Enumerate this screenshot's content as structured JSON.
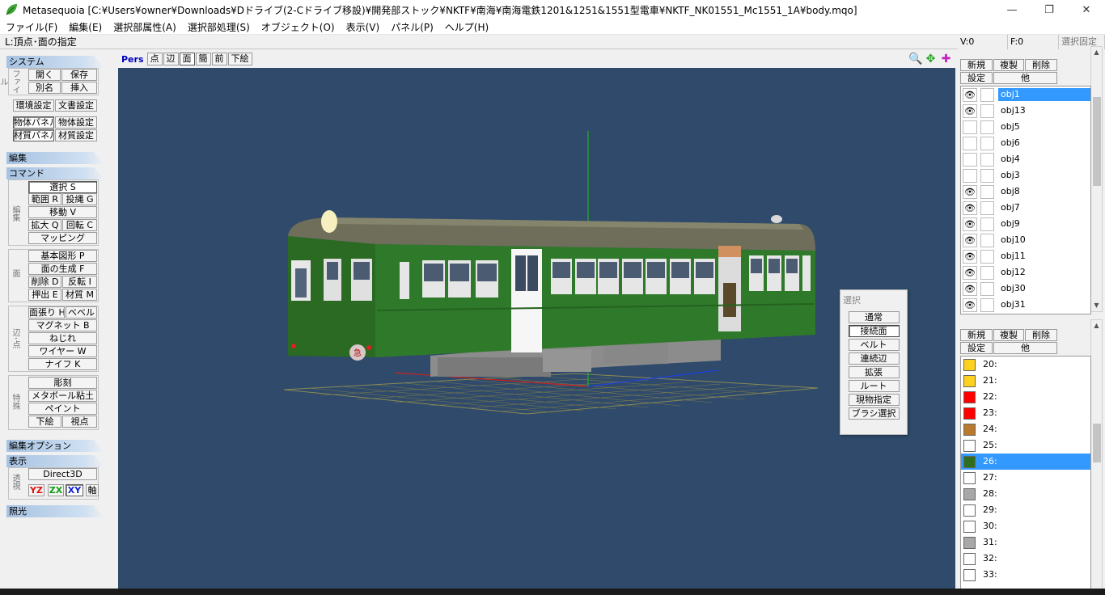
{
  "window": {
    "title": "Metasequoia [C:¥Users¥owner¥Downloads¥Dドライブ(2-Cドライブ移設)¥開発部ストック¥NKTF¥南海¥南海電鉄1201&1251&1551型電車¥NKTF_NK01551_Mc1551_1A¥body.mqo]",
    "minimize": "—",
    "maximize": "❐",
    "close": "✕"
  },
  "menu": [
    "ファイル(F)",
    "編集(E)",
    "選択部属性(A)",
    "選択部処理(S)",
    "オブジェクト(O)",
    "表示(V)",
    "パネル(P)",
    "ヘルプ(H)"
  ],
  "status": "L:頂点･面の指定",
  "left": {
    "system": {
      "header": "システム",
      "file_label": "ファイル",
      "open": "開く",
      "save": "保存",
      "rename": "別名",
      "insert": "挿入",
      "env": "環境設定",
      "doc": "文書設定",
      "objpanel": "物体パネル",
      "objset": "物体設定",
      "matpanel": "材質パネル",
      "matset": "材質設定"
    },
    "edit_header": "編集",
    "command": {
      "header": "コマンド",
      "edit_label": "編集",
      "select": "選択 S",
      "range": "範囲 R",
      "lasso": "投縄 G",
      "move": "移動 V",
      "scale": "拡大 Q",
      "rotate": "回転 C",
      "mapping": "マッピング",
      "face_label": "面",
      "primitive": "基本図形 P",
      "create_face": "面の生成 F",
      "delete": "削除 D",
      "flip": "反転 I",
      "extrude": "押出 E",
      "material": "材質 M",
      "edge_label": "辺･点",
      "facet": "面張り H",
      "bevel": "ベベル",
      "magnet": "マグネット B",
      "twist": "ねじれ",
      "wire": "ワイヤー W",
      "knife": "ナイフ K",
      "special_label": "特殊",
      "sculpt": "彫刻",
      "metaball": "メタボール粘土",
      "paint": "ペイント",
      "underlay": "下絵",
      "viewpoint": "視点"
    },
    "edit_option_header": "編集オプション",
    "display": {
      "header": "表示",
      "persp_label": "透視",
      "renderer": "Direct3D",
      "yz": "YZ",
      "zx": "ZX",
      "xy": "XY",
      "axis": "軸"
    },
    "lighting_header": "照光"
  },
  "viewport": {
    "mode": "Pers",
    "buttons": [
      "点",
      "辺",
      "面",
      "簡",
      "前",
      "下絵"
    ],
    "zoom_icon": "🔍",
    "move_icon": "✥",
    "rotate_icon": "✚",
    "colors": {
      "background": "#2f4a6a",
      "body": "#2f7a2a",
      "roof": "#6e6e5a",
      "under": "#8a8a8a"
    }
  },
  "selection_panel": {
    "title": "選択",
    "items": [
      "通常",
      "接続面",
      "ベルト",
      "連続辺",
      "拡張",
      "ルート",
      "現物指定",
      "ブラシ選択"
    ]
  },
  "right": {
    "v_count": "V:0",
    "f_count": "F:0",
    "sel_fixed": "選択固定",
    "obj_buttons": {
      "new": "新規",
      "duplicate": "複製",
      "delete": "削除",
      "settings": "設定",
      "other": "他"
    },
    "objects": [
      {
        "name": "obj1",
        "visible": true
      },
      {
        "name": "obj13",
        "visible": true
      },
      {
        "name": "obj5",
        "visible": false
      },
      {
        "name": "obj6",
        "visible": false
      },
      {
        "name": "obj4",
        "visible": false
      },
      {
        "name": "obj3",
        "visible": false
      },
      {
        "name": "obj8",
        "visible": true
      },
      {
        "name": "obj7",
        "visible": true
      },
      {
        "name": "obj9",
        "visible": true
      },
      {
        "name": "obj10",
        "visible": true
      },
      {
        "name": "obj11",
        "visible": true
      },
      {
        "name": "obj12",
        "visible": true
      },
      {
        "name": "obj30",
        "visible": true
      },
      {
        "name": "obj31",
        "visible": true
      }
    ],
    "mat_buttons": {
      "new": "新規",
      "duplicate": "複製",
      "delete": "削除",
      "settings": "設定",
      "other": "他"
    },
    "materials": [
      {
        "name": "20:",
        "color": "#ffd21e"
      },
      {
        "name": "21:",
        "color": "#ffd21e"
      },
      {
        "name": "22:",
        "color": "#ff0000"
      },
      {
        "name": "23:",
        "color": "#ff0000"
      },
      {
        "name": "24:",
        "color": "#b87a2e"
      },
      {
        "name": "25:",
        "color": "#ffffff"
      },
      {
        "name": "26:",
        "color": "#2e6e1e"
      },
      {
        "name": "27:",
        "color": "#ffffff"
      },
      {
        "name": "28:",
        "color": "#a8a8a8"
      },
      {
        "name": "29:",
        "color": "#ffffff"
      },
      {
        "name": "30:",
        "color": "#ffffff"
      },
      {
        "name": "31:",
        "color": "#a8a8a8"
      },
      {
        "name": "32:",
        "color": "#ffffff"
      },
      {
        "name": "33:",
        "color": "#ffffff"
      }
    ]
  }
}
